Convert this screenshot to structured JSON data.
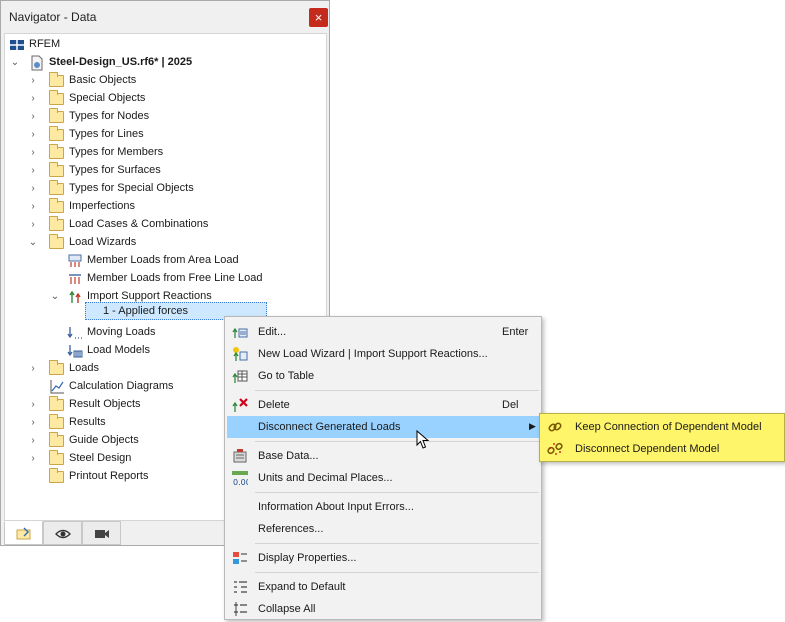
{
  "window": {
    "title": "Navigator - Data",
    "close_label": "×"
  },
  "tree": {
    "root_label": "RFEM",
    "project_label": "Steel-Design_US.rf6* | 2025",
    "folders_top": [
      "Basic Objects",
      "Special Objects",
      "Types for Nodes",
      "Types for Lines",
      "Types for Members",
      "Types for Surfaces",
      "Types for Special Objects",
      "Imperfections",
      "Load Cases & Combinations",
      "Load Wizards"
    ],
    "wizard_items": [
      "Member Loads from Area Load",
      "Member Loads from Free Line Load",
      "Import Support Reactions"
    ],
    "selected_item": "1 - Applied forces",
    "wizard_items_after": [
      "Moving Loads",
      "Load Models"
    ],
    "folders_bottom": [
      "Loads",
      "Calculation Diagrams",
      "Result Objects",
      "Results",
      "Guide Objects",
      "Steel Design",
      "Printout Reports"
    ]
  },
  "context_menu": {
    "items": [
      {
        "label": "Edit...",
        "shortcut": "Enter"
      },
      {
        "label": "New Load Wizard | Import Support Reactions...",
        "shortcut": ""
      },
      {
        "label": "Go to Table",
        "shortcut": ""
      },
      {
        "label": "Delete",
        "shortcut": "Del"
      },
      {
        "label": "Disconnect Generated Loads",
        "shortcut": ""
      },
      {
        "label": "Base Data...",
        "shortcut": ""
      },
      {
        "label": "Units and Decimal Places...",
        "shortcut": ""
      },
      {
        "label": "Information About Input Errors...",
        "shortcut": ""
      },
      {
        "label": "References...",
        "shortcut": ""
      },
      {
        "label": "Display Properties...",
        "shortcut": ""
      },
      {
        "label": "Expand to Default",
        "shortcut": ""
      },
      {
        "label": "Collapse All",
        "shortcut": ""
      }
    ],
    "submenu_arrow": "▶"
  },
  "submenu": {
    "items": [
      {
        "label": "Keep Connection of Dependent Model"
      },
      {
        "label": "Disconnect Dependent Model"
      }
    ]
  },
  "colors": {
    "highlight": "#99d1ff",
    "submenu_bg": "#fff56a",
    "folder": "#fde9a1",
    "close": "#c42b1c"
  },
  "icons": {
    "bottom_tabs": [
      "data-tab-icon",
      "eye-icon",
      "camera-icon"
    ]
  }
}
